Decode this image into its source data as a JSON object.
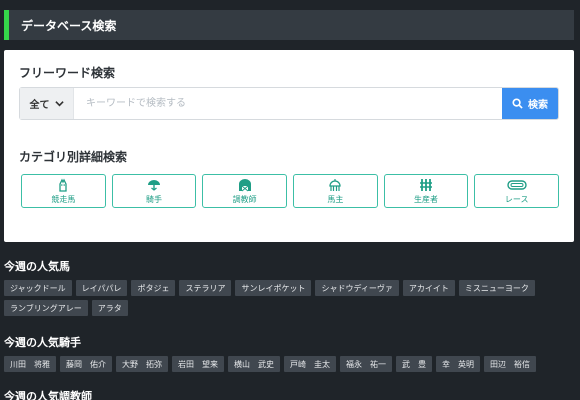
{
  "header": {
    "title": "データベース検索"
  },
  "freeword": {
    "title": "フリーワード検索",
    "scope": "全て",
    "placeholder": "キーワードで検索する",
    "button": "検索"
  },
  "category": {
    "title": "カテゴリ別詳細検索",
    "items": [
      {
        "label": "競走馬",
        "icon": "horse-head-icon"
      },
      {
        "label": "騎手",
        "icon": "jockey-helmet-icon"
      },
      {
        "label": "調教師",
        "icon": "stable-icon"
      },
      {
        "label": "馬主",
        "icon": "owner-icon"
      },
      {
        "label": "生産者",
        "icon": "fence-icon"
      },
      {
        "label": "レース",
        "icon": "race-track-icon"
      }
    ]
  },
  "popular_horses": {
    "title": "今週の人気馬",
    "tags": [
      "ジャックドール",
      "レイパパレ",
      "ポタジェ",
      "ステラリア",
      "サンレイポケット",
      "シャドウディーヴァ",
      "アカイイト",
      "ミスニューヨーク",
      "ランブリングアレー",
      "アラタ"
    ]
  },
  "popular_jockeys": {
    "title": "今週の人気騎手",
    "tags": [
      "川田　将雅",
      "藤岡　佑介",
      "大野　拓弥",
      "岩田　望来",
      "横山　武史",
      "戸崎　圭太",
      "福永　祐一",
      "武　豊",
      "幸　英明",
      "田辺　裕信"
    ]
  },
  "popular_trainers": {
    "title": "今週の人気調教師"
  },
  "colors": {
    "accent": "#35d64a",
    "button": "#3b8ef0",
    "category": "#1f9e86"
  }
}
